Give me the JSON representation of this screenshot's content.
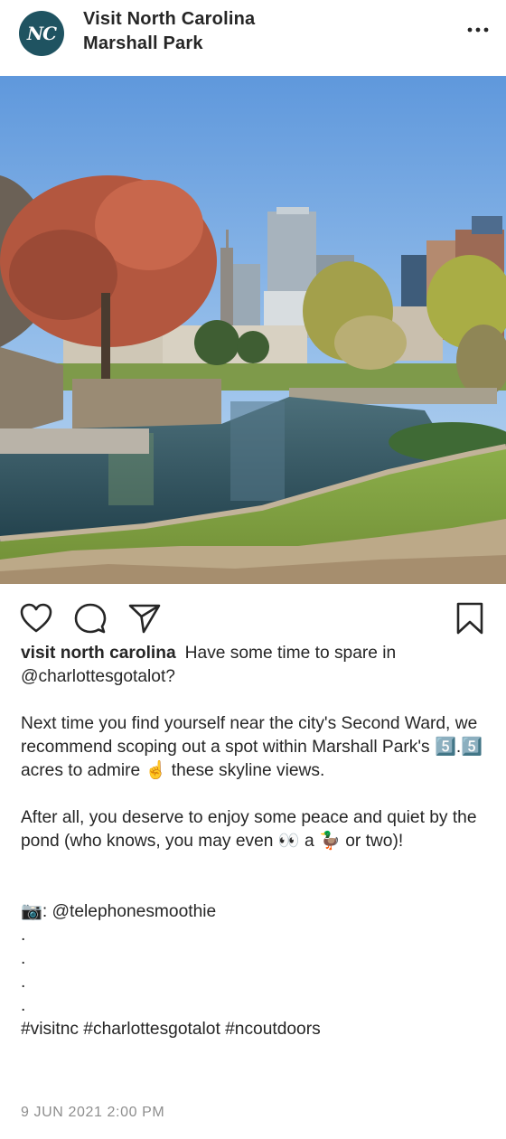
{
  "header": {
    "avatar_text": "NC",
    "account_name": "Visit North Carolina",
    "location": "Marshall Park",
    "more_icon": "more-horizontal-icon"
  },
  "photo": {
    "subject": "Marshall Park pond with Charlotte skyline"
  },
  "actions": {
    "like_icon": "heart-icon",
    "comment_icon": "comment-bubble-icon",
    "share_icon": "paper-plane-icon",
    "save_icon": "bookmark-icon"
  },
  "caption": {
    "username": "visit north carolina",
    "line1": "Have some time to spare in @charlottesgotalot?",
    "para2": "Next time you find yourself near the city's Second Ward, we recommend scoping out a spot within Marshall Park's 5️⃣.5️⃣ acres to admire ☝️ these skyline views.",
    "para3": "After all, you deserve to enjoy some peace and quiet by the pond (who knows, you may even 👀 a 🦆 or two)!",
    "credit": "📷: @telephonesmoothie",
    "dots": [
      ".",
      ".",
      ".",
      "."
    ],
    "hashtags": "#visitnc #charlottesgotalot #ncoutdoors"
  },
  "timestamp": "9 JUN 2021 2:00 PM",
  "colors": {
    "avatar_bg": "#1f5361",
    "text": "#262626",
    "muted": "#8e8e8e",
    "sky": "#7ba9e0"
  }
}
